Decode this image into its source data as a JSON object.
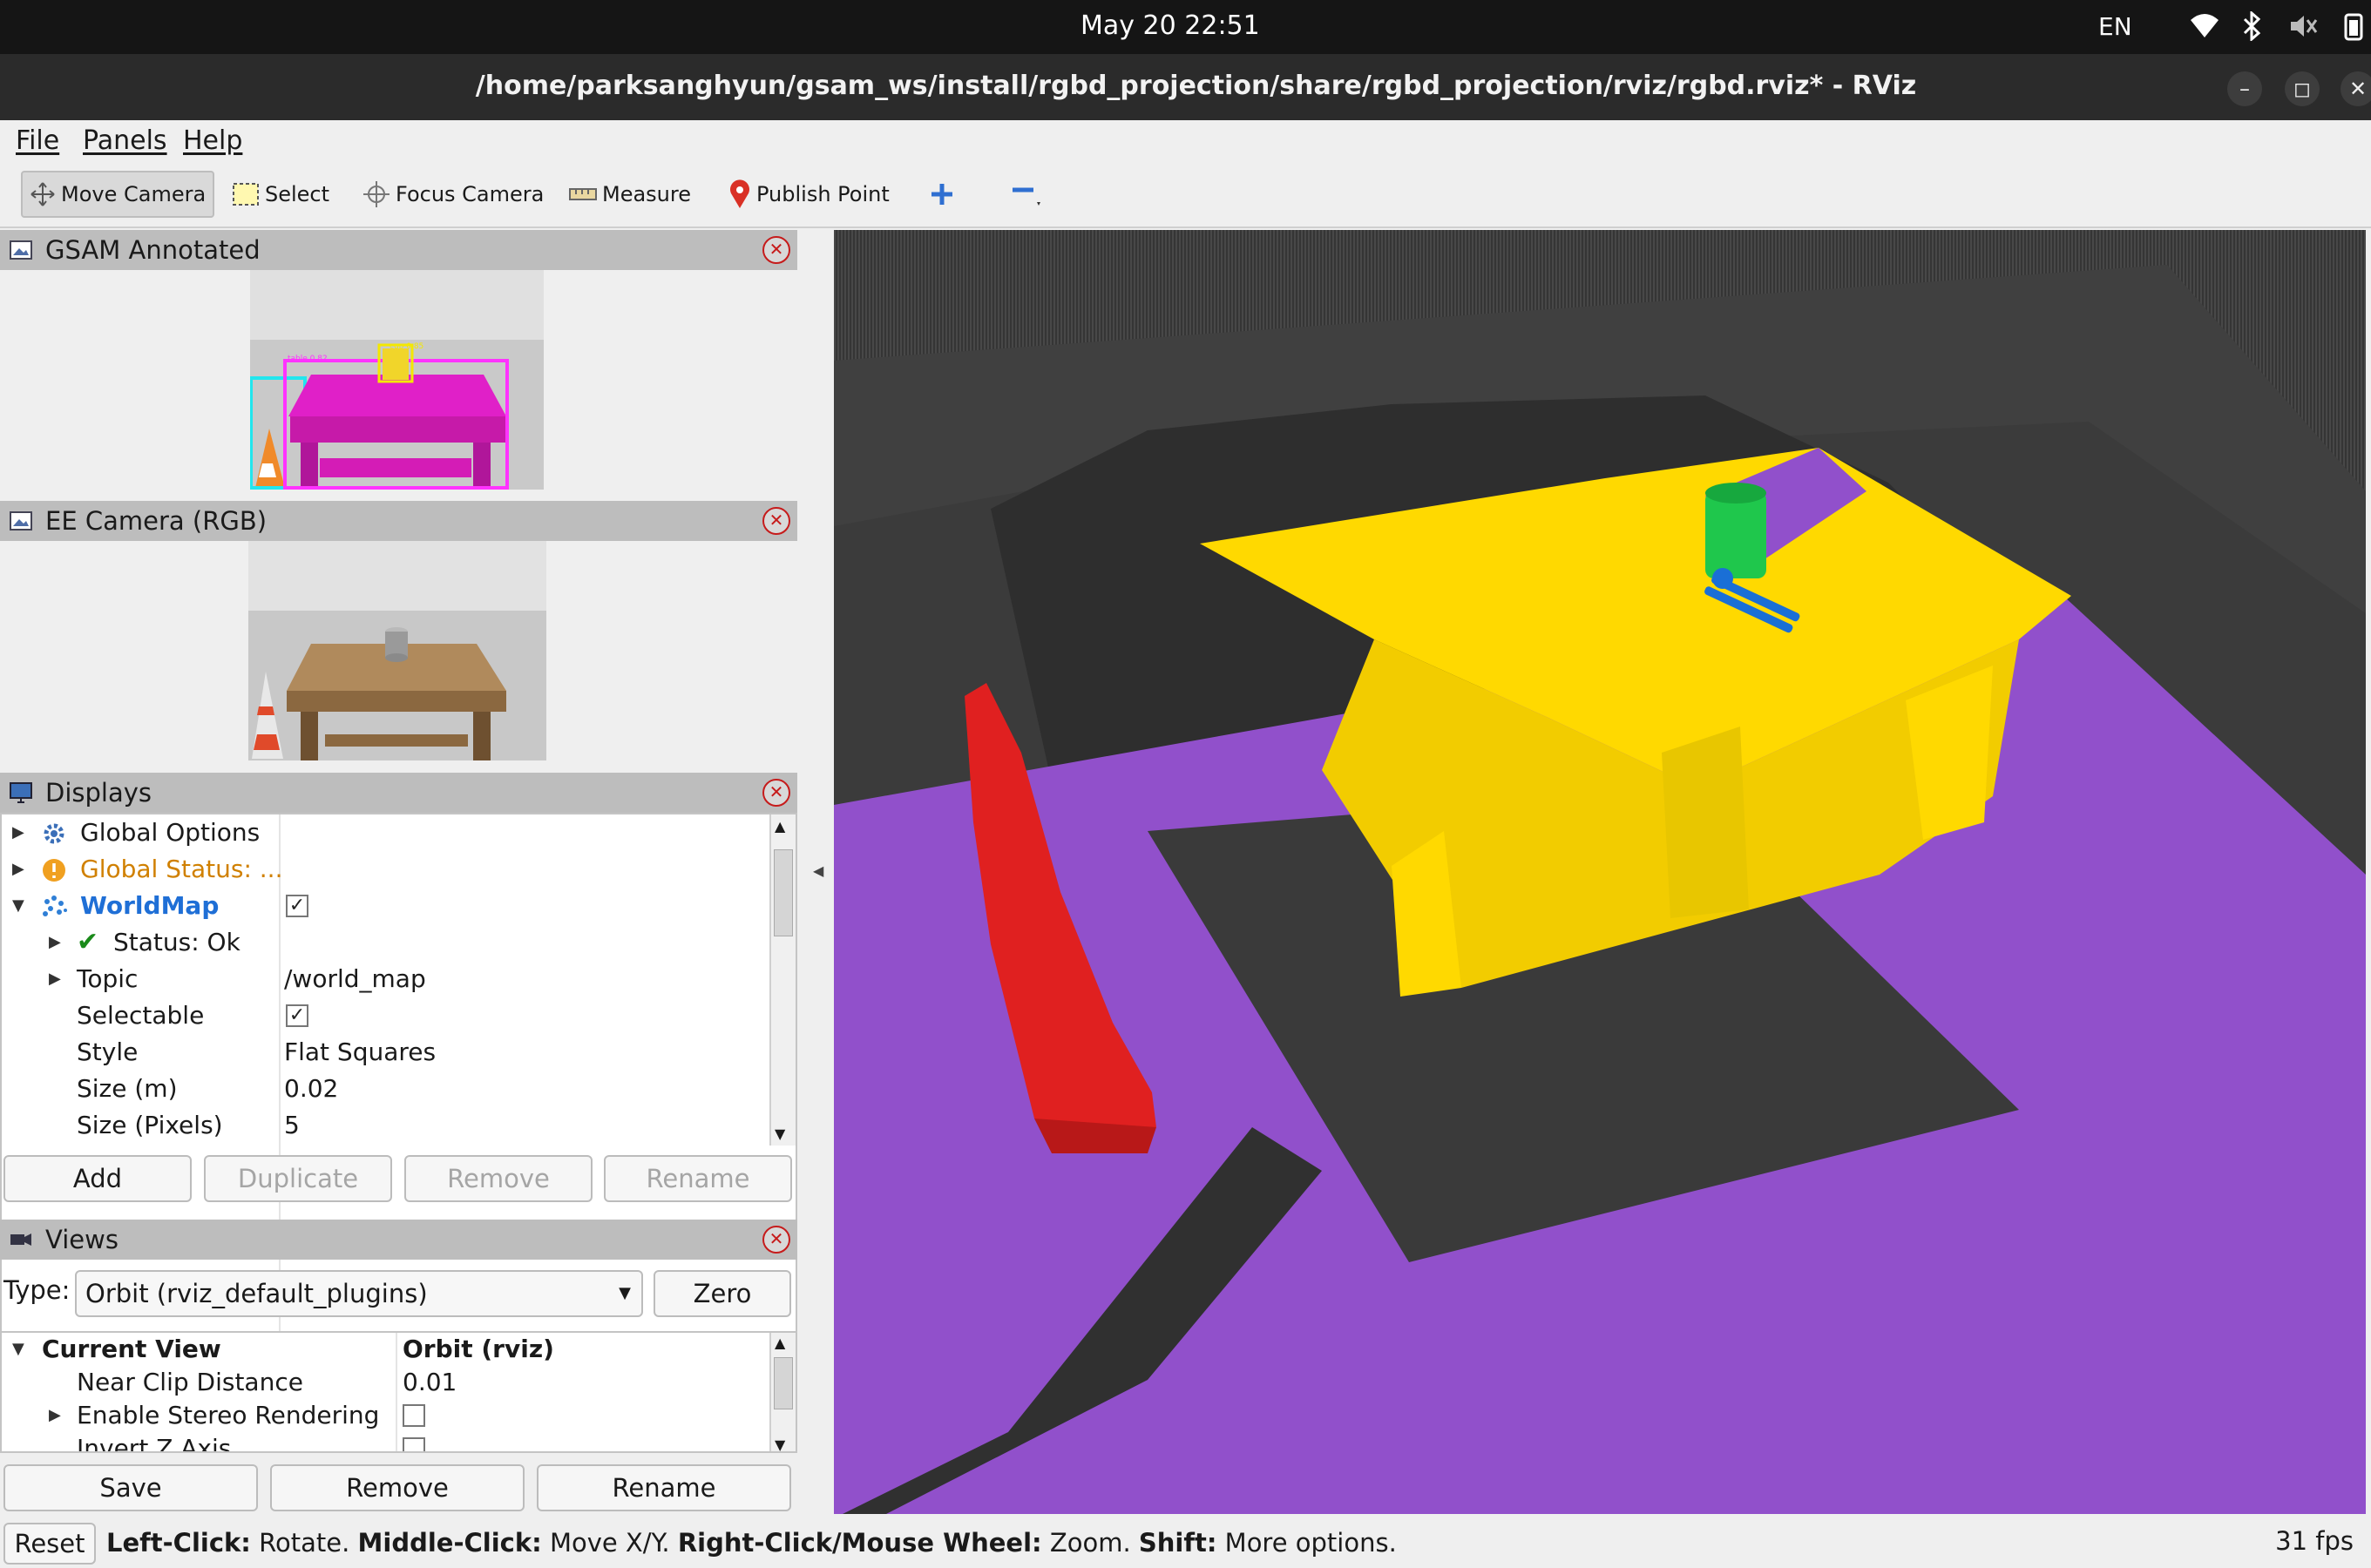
{
  "system_bar": {
    "clock": "May 20  22:51",
    "language": "EN"
  },
  "window": {
    "title": "/home/parksanghyun/gsam_ws/install/rgbd_projection/share/rgbd_projection/rviz/rgbd.rviz* - RViz"
  },
  "menu": [
    "File",
    "Panels",
    "Help"
  ],
  "toolbar": {
    "move_camera": "Move Camera",
    "select": "Select",
    "focus_camera": "Focus Camera",
    "measure": "Measure",
    "publish_point": "Publish Point"
  },
  "panels": {
    "gsam": {
      "title": "GSAM Annotated",
      "labels": {
        "table": "table 0.82",
        "cup": "cup 0.85"
      }
    },
    "ee_camera": {
      "title": "EE Camera (RGB)"
    },
    "displays": {
      "title": "Displays",
      "rows": {
        "global_options": "Global Options",
        "global_status": "Global Status: ...",
        "worldmap": "WorldMap",
        "status": "Status: Ok",
        "topic": "Topic",
        "topic_value": "/world_map",
        "selectable": "Selectable",
        "style": "Style",
        "style_value": "Flat Squares",
        "size_m": "Size (m)",
        "size_m_value": "0.02",
        "size_px": "Size (Pixels)",
        "size_px_value": "5"
      },
      "buttons": {
        "add": "Add",
        "duplicate": "Duplicate",
        "remove": "Remove",
        "rename": "Rename"
      }
    },
    "views": {
      "title": "Views",
      "type_label": "Type:",
      "type_value": "Orbit (rviz_default_plugins)",
      "zero": "Zero",
      "rows": {
        "current_view": "Current View",
        "current_view_value": "Orbit (rviz)",
        "near_clip": "Near Clip Distance",
        "near_clip_value": "0.01",
        "stereo": "Enable Stereo Rendering",
        "invert_z": "Invert Z Axis"
      },
      "buttons": {
        "save": "Save",
        "remove": "Remove",
        "rename": "Rename"
      }
    }
  },
  "statusbar": {
    "reset": "Reset",
    "left_click": "Left-Click:",
    "left_click_desc": "Rotate.",
    "middle_click": "Middle-Click:",
    "middle_click_desc": "Move X/Y.",
    "right_click": "Right-Click/Mouse Wheel:",
    "right_click_desc": "Zoom.",
    "shift": "Shift:",
    "shift_desc": "More options.",
    "fps": "31 fps"
  },
  "colors": {
    "floor": "#9150cb",
    "table": "#ffd900",
    "cup": "#1fc74c",
    "gripper": "#1a6fd6",
    "cone": "#e02020",
    "annot_box": "#ff33ff",
    "annot_cyan": "#22e6ee"
  }
}
